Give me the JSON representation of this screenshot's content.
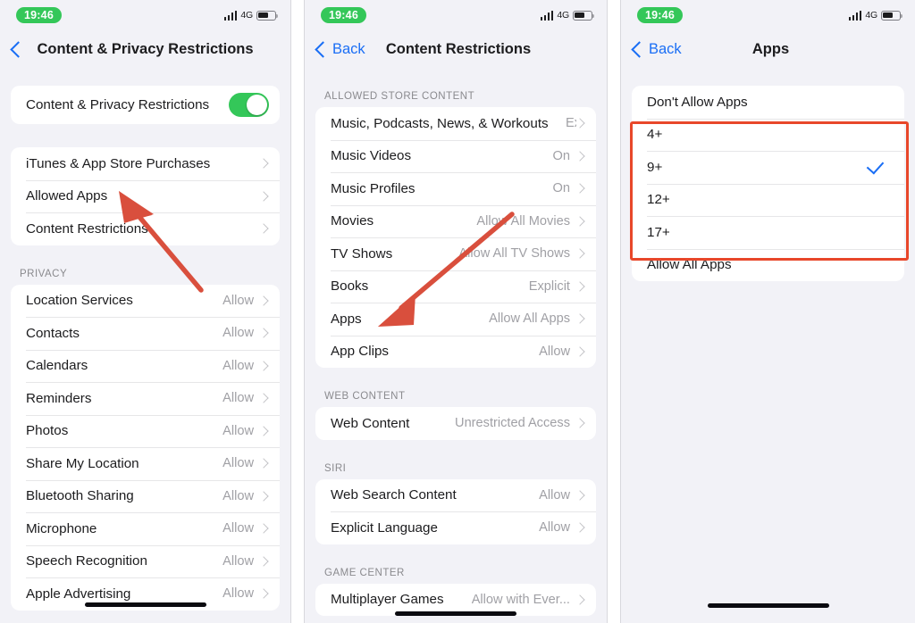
{
  "status_bar": {
    "time": "19:46",
    "network": "4G",
    "signal_icon": "signal-bars-icon",
    "battery_icon": "battery-icon"
  },
  "panel1": {
    "nav": {
      "back_icon": "chevron-left-icon",
      "back_label": "",
      "title": "Content & Privacy Restrictions"
    },
    "master_toggle": {
      "label": "Content & Privacy Restrictions",
      "state": "on",
      "color": "#34c759"
    },
    "settings_group": [
      {
        "label": "iTunes & App Store Purchases",
        "value": ""
      },
      {
        "label": "Allowed Apps",
        "value": ""
      },
      {
        "label": "Content Restrictions",
        "value": ""
      }
    ],
    "privacy_header": "PRIVACY",
    "privacy_group": [
      {
        "label": "Location Services",
        "value": "Allow"
      },
      {
        "label": "Contacts",
        "value": "Allow"
      },
      {
        "label": "Calendars",
        "value": "Allow"
      },
      {
        "label": "Reminders",
        "value": "Allow"
      },
      {
        "label": "Photos",
        "value": "Allow"
      },
      {
        "label": "Share My Location",
        "value": "Allow"
      },
      {
        "label": "Bluetooth Sharing",
        "value": "Allow"
      },
      {
        "label": "Microphone",
        "value": "Allow"
      },
      {
        "label": "Speech Recognition",
        "value": "Allow"
      },
      {
        "label": "Apple Advertising",
        "value": "Allow"
      }
    ]
  },
  "panel2": {
    "nav": {
      "back_icon": "chevron-left-icon",
      "back_label": "Back",
      "title": "Content Restrictions"
    },
    "store_header": "ALLOWED STORE CONTENT",
    "store_group": [
      {
        "label": "Music, Podcasts, News, & Workouts",
        "value": "Explicit"
      },
      {
        "label": "Music Videos",
        "value": "On"
      },
      {
        "label": "Music Profiles",
        "value": "On"
      },
      {
        "label": "Movies",
        "value": "Allow All Movies"
      },
      {
        "label": "TV Shows",
        "value": "Allow All TV Shows"
      },
      {
        "label": "Books",
        "value": "Explicit"
      },
      {
        "label": "Apps",
        "value": "Allow All Apps"
      },
      {
        "label": "App Clips",
        "value": "Allow"
      }
    ],
    "web_header": "WEB CONTENT",
    "web_group": [
      {
        "label": "Web Content",
        "value": "Unrestricted Access"
      }
    ],
    "siri_header": "SIRI",
    "siri_group": [
      {
        "label": "Web Search Content",
        "value": "Allow"
      },
      {
        "label": "Explicit Language",
        "value": "Allow"
      }
    ],
    "gamecenter_header": "GAME CENTER",
    "gamecenter_group": [
      {
        "label": "Multiplayer Games",
        "value": "Allow with Ever..."
      }
    ]
  },
  "panel3": {
    "nav": {
      "back_icon": "chevron-left-icon",
      "back_label": "Back",
      "title": "Apps"
    },
    "options": [
      {
        "label": "Don't Allow Apps",
        "selected": false
      },
      {
        "label": "4+",
        "selected": false
      },
      {
        "label": "9+",
        "selected": true
      },
      {
        "label": "12+",
        "selected": false
      },
      {
        "label": "17+",
        "selected": false
      },
      {
        "label": "Allow All Apps",
        "selected": false
      }
    ],
    "selected_value": "9+",
    "check_icon": "checkmark-icon"
  },
  "annotations": {
    "highlight_color": "#e8472a",
    "arrow_color": "#d94f3d",
    "arrow1_target": "Allowed Apps",
    "arrow2_target": "Apps",
    "highlight_box_target": "age-rating-options"
  }
}
